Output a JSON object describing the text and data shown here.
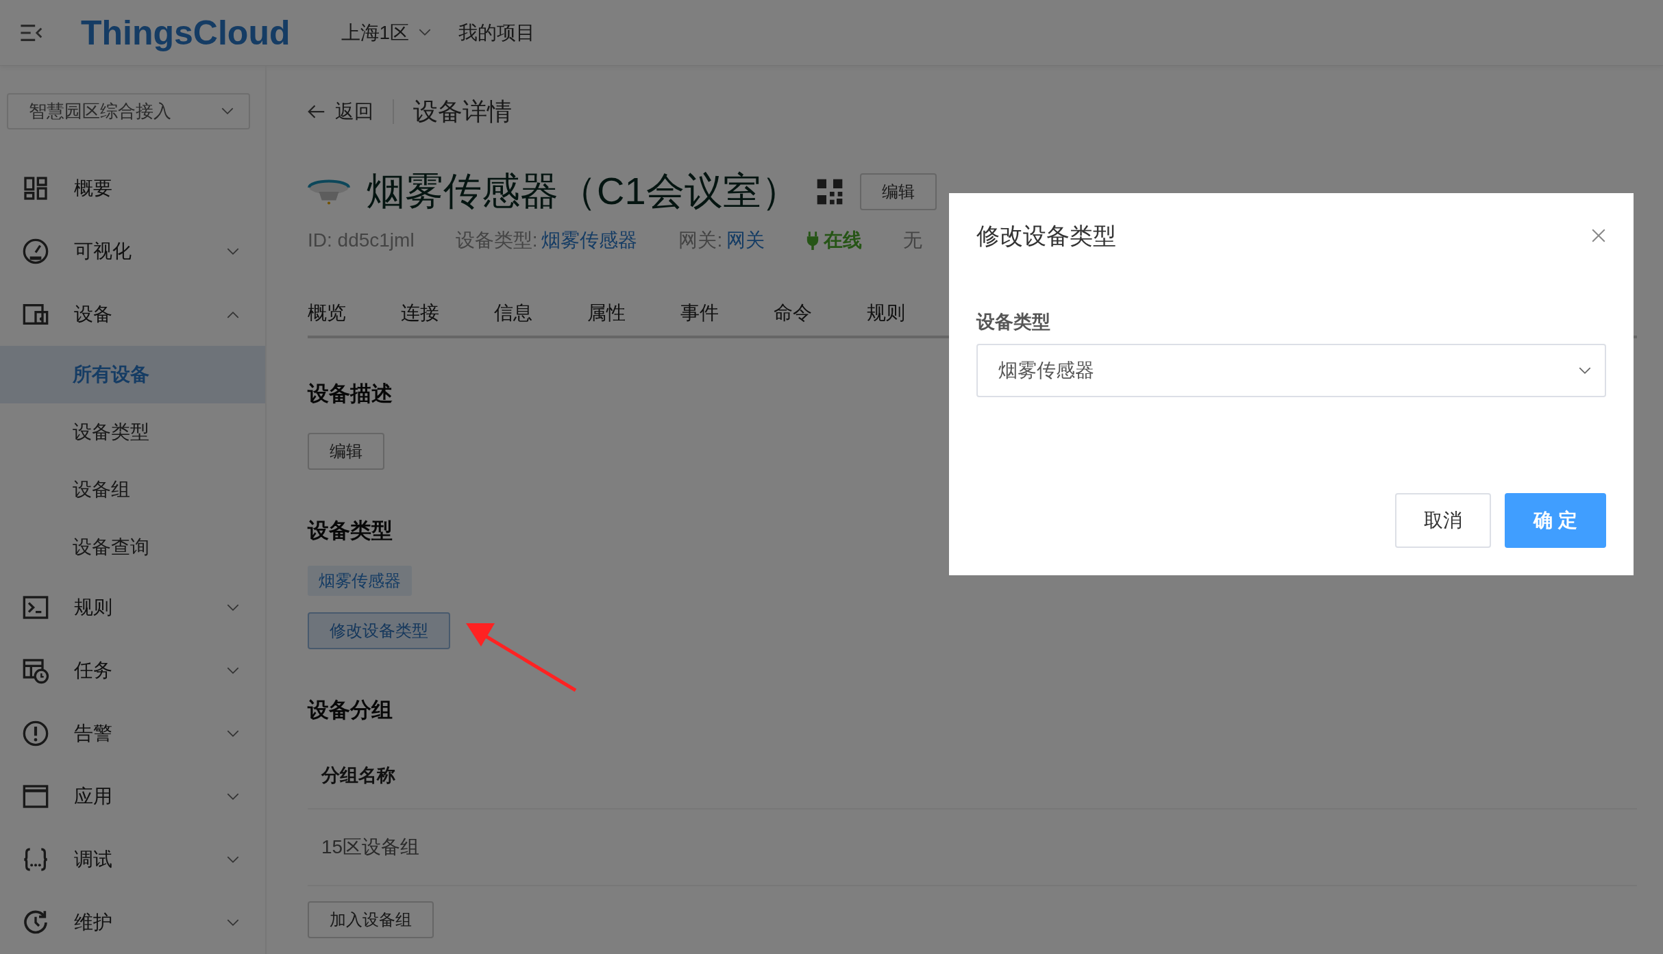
{
  "top_bar": {
    "logo": "ThingsCloud",
    "region": "上海1区",
    "projects": "我的项目"
  },
  "sidebar": {
    "project_select": "智慧园区综合接入",
    "items": [
      {
        "label": "概要",
        "kind": "link"
      },
      {
        "label": "可视化",
        "kind": "group",
        "expanded": false
      },
      {
        "label": "设备",
        "kind": "group",
        "expanded": true,
        "children": [
          {
            "label": "所有设备",
            "selected": true
          },
          {
            "label": "设备类型",
            "selected": false
          },
          {
            "label": "设备组",
            "selected": false
          },
          {
            "label": "设备查询",
            "selected": false
          }
        ]
      },
      {
        "label": "规则",
        "kind": "group",
        "expanded": false
      },
      {
        "label": "任务",
        "kind": "group",
        "expanded": false
      },
      {
        "label": "告警",
        "kind": "group",
        "expanded": false
      },
      {
        "label": "应用",
        "kind": "group",
        "expanded": false
      },
      {
        "label": "调试",
        "kind": "group",
        "expanded": false
      },
      {
        "label": "维护",
        "kind": "group",
        "expanded": false
      }
    ]
  },
  "header": {
    "back": "返回",
    "page_title": "设备详情",
    "device_name": "烟雾传感器（C1会议室）",
    "edit_button": "编辑"
  },
  "meta": {
    "id": "ID: dd5c1jml",
    "type_label": "设备类型:",
    "type_link": "烟雾传感器",
    "gateway_label": "网关:",
    "gateway_link": "网关",
    "status": "在线",
    "online": true,
    "alarm": "无"
  },
  "tabs": [
    {
      "label": "概览"
    },
    {
      "label": "连接"
    },
    {
      "label": "信息"
    },
    {
      "label": "属性"
    },
    {
      "label": "事件"
    },
    {
      "label": "命令"
    },
    {
      "label": "规则"
    }
  ],
  "description": {
    "heading": "设备描述",
    "edit_button": "编辑"
  },
  "device_type": {
    "heading": "设备类型",
    "tag": "烟雾传感器",
    "change_button": "修改设备类型"
  },
  "groups": {
    "heading": "设备分组",
    "column": "分组名称",
    "rows": [
      "15区设备组"
    ],
    "add_button": "加入设备组"
  },
  "dialog": {
    "title": "修改设备类型",
    "field_label": "设备类型",
    "select_value": "烟雾传感器",
    "cancel": "取消",
    "confirm": "确 定"
  }
}
